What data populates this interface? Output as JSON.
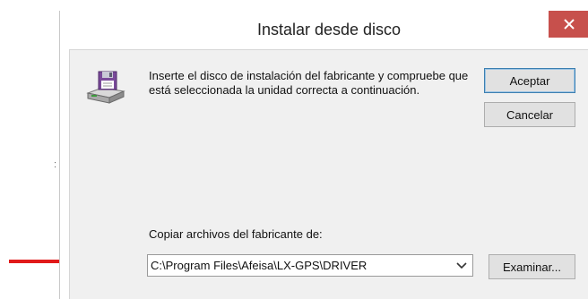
{
  "dialog": {
    "title": "Instalar desde disco",
    "message": "Inserte el disco de instalación del fabricante y compruebe que está seleccionada la unidad correcta a continuación.",
    "buttons": {
      "ok_label": "Aceptar",
      "cancel_label": "Cancelar",
      "browse_label": "Examinar..."
    },
    "copy_from": {
      "label": "Copiar archivos del fabricante de:",
      "value": "C:\\Program Files\\Afeisa\\LX-GPS\\DRIVER"
    }
  },
  "background": {
    "stray_mark": ":"
  },
  "colors": {
    "close_button": "#c7504c",
    "annotation_arrow": "#e11a1a",
    "client_area": "#f0f0f0"
  },
  "icons": {
    "close": "close-icon",
    "disk": "floppy-drive-icon",
    "dropdown": "chevron-down-icon",
    "annotation": "red-arrow-icon"
  }
}
